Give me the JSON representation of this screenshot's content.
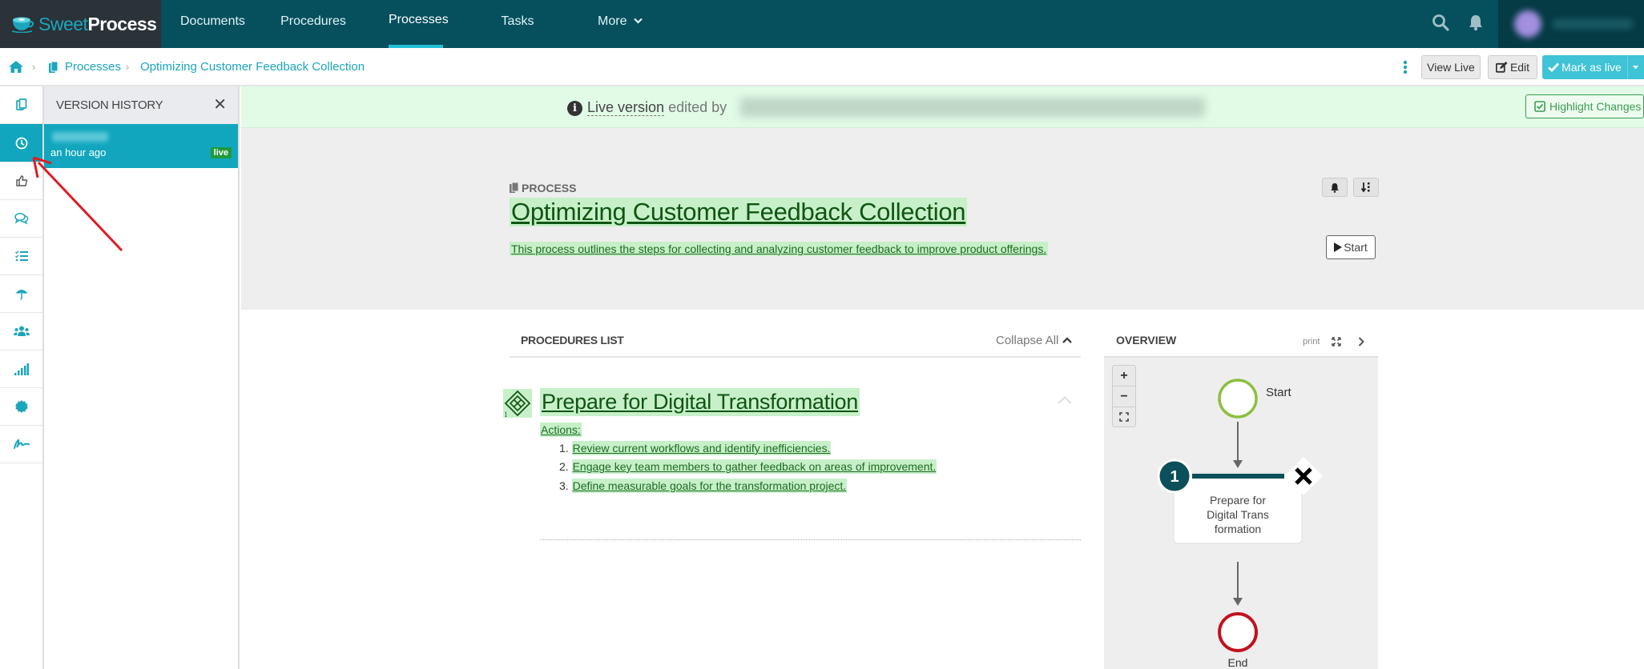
{
  "app": {
    "logo_part1": "Sweet",
    "logo_part2": "Process"
  },
  "nav": {
    "items": [
      {
        "label": "Documents",
        "active": false
      },
      {
        "label": "Procedures",
        "active": false
      },
      {
        "label": "Processes",
        "active": true
      },
      {
        "label": "Tasks",
        "active": false
      },
      {
        "label": "More",
        "active": false
      }
    ],
    "search_icon": "search-icon",
    "notifications_icon": "bell-icon"
  },
  "breadcrumb": {
    "home_icon": "home-icon",
    "items": [
      "Processes",
      "Optimizing Customer Feedback Collection"
    ]
  },
  "toolbar": {
    "more_icon": "vertical-ellipsis-icon",
    "view_live_label": "View Live",
    "edit_label": "Edit",
    "mark_live_label": "Mark as live"
  },
  "sidebar": {
    "items": [
      {
        "icon": "copy-icon",
        "active": false
      },
      {
        "icon": "clock-icon",
        "active": true
      },
      {
        "icon": "thumbs-up-icon",
        "active": false
      },
      {
        "icon": "comments-icon",
        "active": false
      },
      {
        "icon": "checklist-icon",
        "active": false
      },
      {
        "icon": "umbrella-icon",
        "active": false
      },
      {
        "icon": "users-icon",
        "active": false
      },
      {
        "icon": "signal-bars-icon",
        "active": false
      },
      {
        "icon": "badge-icon",
        "active": false
      },
      {
        "icon": "signature-icon",
        "active": false
      }
    ]
  },
  "version_history": {
    "title": "VERSION HISTORY",
    "entries": [
      {
        "time": "an hour ago",
        "badge": "live"
      }
    ]
  },
  "banner": {
    "live_version": "Live version",
    "edited_by": "edited by",
    "highlight_changes": "Highlight Changes"
  },
  "process": {
    "label": "PROCESS",
    "title": "Optimizing Customer Feedback Collection",
    "description": "This process outlines the steps for collecting and analyzing customer feedback to improve product offerings.",
    "start_label": "Start"
  },
  "procedures_list": {
    "title": "PROCEDURES LIST",
    "collapse_all": "Collapse All",
    "procedures": [
      {
        "number": "1",
        "title": "Prepare for Digital Transformation",
        "actions_label": "Actions:",
        "actions": [
          "Review current workflows and identify inefficiencies.",
          "Engage key team members to gather feedback on areas of improvement.",
          "Define measurable goals for the transformation project."
        ]
      }
    ]
  },
  "overview": {
    "title": "OVERVIEW",
    "print": "print",
    "zoom_in": "+",
    "zoom_out": "−",
    "diagram": {
      "start_label": "Start",
      "end_label": "End",
      "step_number": "1",
      "step_lines": [
        "Prepare for",
        "Digital Trans",
        "formation"
      ]
    },
    "colors": {
      "start": "#8cbf3f",
      "end": "#c0121f",
      "step_badge": "#0b4f5a"
    }
  }
}
